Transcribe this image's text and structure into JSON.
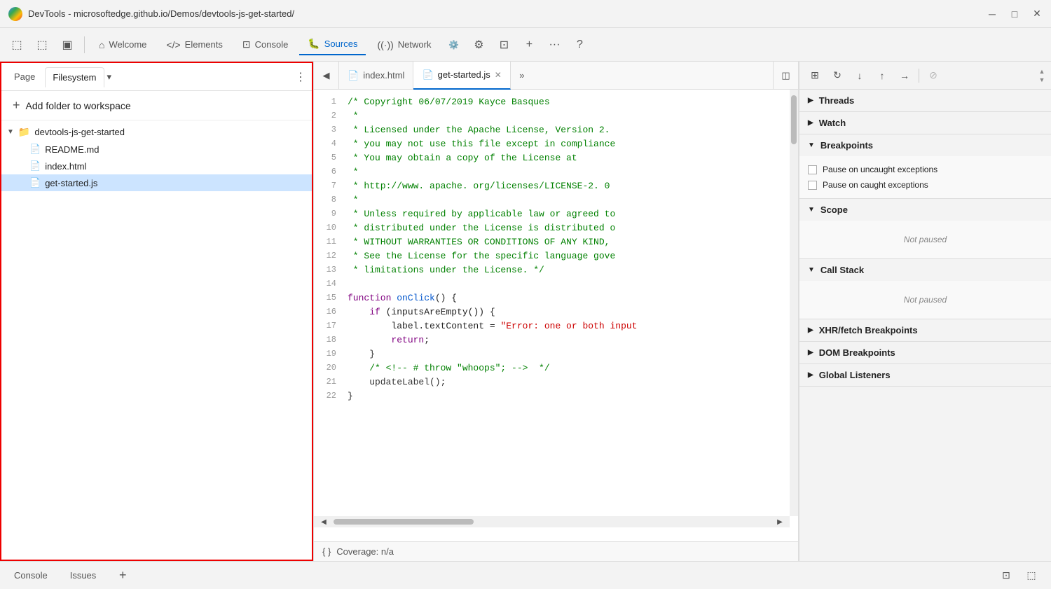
{
  "titlebar": {
    "title": "DevTools - microsoftedge.github.io/Demos/devtools-js-get-started/",
    "minimize": "─",
    "maximize": "□",
    "close": "✕"
  },
  "toolbar": {
    "icons": [
      "⬚",
      "⬚",
      "▣"
    ],
    "tabs": [
      {
        "id": "welcome",
        "label": "Welcome",
        "icon": "⌂",
        "active": false
      },
      {
        "id": "elements",
        "label": "Elements",
        "icon": "</>",
        "active": false
      },
      {
        "id": "console",
        "label": "Console",
        "icon": "⊡",
        "active": false
      },
      {
        "id": "sources",
        "label": "Sources",
        "icon": "🐛",
        "active": true
      },
      {
        "id": "network",
        "label": "Network",
        "icon": "((·))",
        "active": false
      }
    ],
    "extra_icons": [
      "⚙",
      "⊡",
      "+",
      "···",
      "?"
    ]
  },
  "left_panel": {
    "tabs": [
      {
        "id": "page",
        "label": "Page",
        "active": false
      },
      {
        "id": "filesystem",
        "label": "Filesystem",
        "active": true
      }
    ],
    "add_folder_label": "Add folder to workspace",
    "folder": {
      "name": "devtools-js-get-started",
      "expanded": true,
      "files": [
        {
          "name": "README.md",
          "type": "md"
        },
        {
          "name": "index.html",
          "type": "html"
        },
        {
          "name": "get-started.js",
          "type": "js"
        }
      ]
    }
  },
  "editor": {
    "tabs": [
      {
        "id": "index.html",
        "label": "index.html",
        "icon": "📄",
        "active": false,
        "closeable": false
      },
      {
        "id": "get-started.js",
        "label": "get-started.js",
        "icon": "📄",
        "active": true,
        "closeable": true
      }
    ],
    "code_lines": [
      {
        "num": 1,
        "content": "/* Copyright 06/07/2019 Kayce Basques",
        "class": "c-green"
      },
      {
        "num": 2,
        "content": " *",
        "class": "c-green"
      },
      {
        "num": 3,
        "content": " * Licensed under the Apache License, Version 2.",
        "class": "c-green"
      },
      {
        "num": 4,
        "content": " * you may not use this file except in compliance",
        "class": "c-green"
      },
      {
        "num": 5,
        "content": " * You may obtain a copy of the License at",
        "class": "c-green"
      },
      {
        "num": 6,
        "content": " *",
        "class": "c-green"
      },
      {
        "num": 7,
        "content": " * http://www. apache. org/licenses/LICENSE-2. 0",
        "class": "c-green"
      },
      {
        "num": 8,
        "content": " *",
        "class": "c-green"
      },
      {
        "num": 9,
        "content": " * Unless required by applicable law or agreed to",
        "class": "c-green"
      },
      {
        "num": 10,
        "content": " * distributed under the License is distributed o",
        "class": "c-green"
      },
      {
        "num": 11,
        "content": " * WITHOUT WARRANTIES OR CONDITIONS OF ANY KIND,",
        "class": "c-green"
      },
      {
        "num": 12,
        "content": " * See the License for the specific language gove",
        "class": "c-green"
      },
      {
        "num": 13,
        "content": " * limitations under the License. */",
        "class": "c-green"
      },
      {
        "num": 14,
        "content": "",
        "class": "c-dark"
      },
      {
        "num": 15,
        "content": "function onClick() {",
        "class": "c-dark",
        "has_keyword": true,
        "keyword": "function",
        "func": "onClick"
      },
      {
        "num": 16,
        "content": "    if (inputsAreEmpty()) {",
        "class": "c-dark"
      },
      {
        "num": 17,
        "content": "        label.textContent = \"Error: one or both input",
        "class": "c-dark",
        "has_string": true
      },
      {
        "num": 18,
        "content": "        return;",
        "class": "c-dark"
      },
      {
        "num": 19,
        "content": "    }",
        "class": "c-dark"
      },
      {
        "num": 20,
        "content": "    /* <!-- # throw \"whoops\"; -->  */",
        "class": "c-green"
      },
      {
        "num": 21,
        "content": "    updateLabel();",
        "class": "c-dark"
      },
      {
        "num": 22,
        "content": "}",
        "class": "c-dark"
      }
    ],
    "coverage_label": "Coverage: n/a"
  },
  "right_panel": {
    "toolbar_buttons": [
      "⊞",
      "↻",
      "↓",
      "↑",
      "→",
      "⊘"
    ],
    "sections": [
      {
        "id": "threads",
        "label": "Threads",
        "expanded": false,
        "arrow": "▶"
      },
      {
        "id": "watch",
        "label": "Watch",
        "expanded": false,
        "arrow": "▶"
      },
      {
        "id": "breakpoints",
        "label": "Breakpoints",
        "expanded": true,
        "arrow": "▼",
        "checkboxes": [
          {
            "label": "Pause on uncaught exceptions",
            "checked": false
          },
          {
            "label": "Pause on caught exceptions",
            "checked": false
          }
        ]
      },
      {
        "id": "scope",
        "label": "Scope",
        "expanded": true,
        "arrow": "▼",
        "empty_text": "Not paused"
      },
      {
        "id": "call-stack",
        "label": "Call Stack",
        "expanded": true,
        "arrow": "▼",
        "empty_text": "Not paused"
      },
      {
        "id": "xhr-breakpoints",
        "label": "XHR/fetch Breakpoints",
        "expanded": false,
        "arrow": "▶"
      },
      {
        "id": "dom-breakpoints",
        "label": "DOM Breakpoints",
        "expanded": false,
        "arrow": "▶"
      },
      {
        "id": "global-listeners",
        "label": "Global Listeners",
        "expanded": false,
        "arrow": "▶"
      }
    ]
  },
  "bottom_bar": {
    "tabs": [
      {
        "id": "console",
        "label": "Console"
      },
      {
        "id": "issues",
        "label": "Issues"
      }
    ],
    "add_label": "+",
    "right_buttons": [
      "⊡",
      "⬚"
    ]
  }
}
